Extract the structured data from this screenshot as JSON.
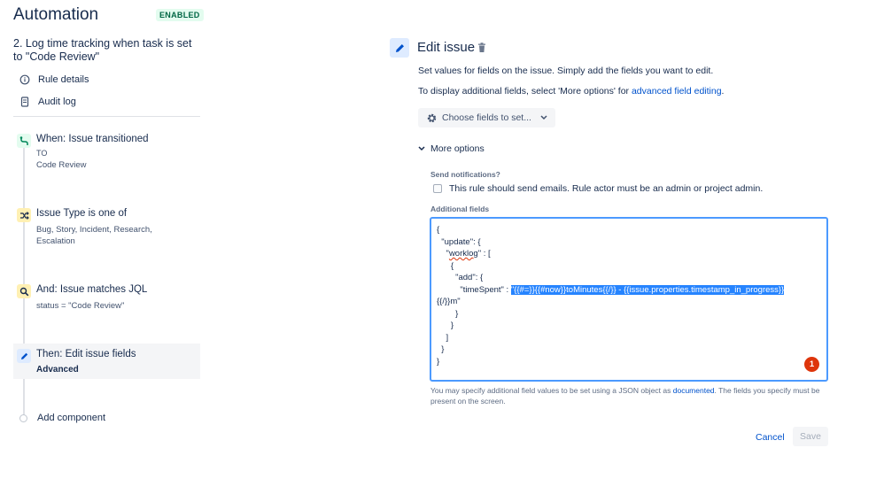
{
  "app": {
    "title": "Automation",
    "status_badge": "ENABLED"
  },
  "rule": {
    "name": "2. Log time tracking when task is set to \"Code Review\""
  },
  "nav": [
    {
      "label": "Rule details",
      "icon": "info-icon"
    },
    {
      "label": "Audit log",
      "icon": "document-icon"
    }
  ],
  "components": [
    {
      "title": "When: Issue transitioned",
      "subtitle_lines": [
        "TO",
        "Code Review"
      ],
      "icon": "transition-icon",
      "color": "#e3fcef"
    },
    {
      "title": "Issue Type is one of",
      "subtitle_lines": [
        "Bug, Story, Incident, Research,",
        "Escalation"
      ],
      "icon": "shuffle-icon",
      "color": "#fff0b3"
    },
    {
      "title": "And: Issue matches JQL",
      "subtitle_lines": [
        "status = \"Code Review\""
      ],
      "icon": "search-icon",
      "color": "#fff0b3"
    },
    {
      "title": "Then: Edit issue fields",
      "subtitle_lines": [
        "Advanced"
      ],
      "icon": "pencil-icon",
      "color": "#deebff",
      "selected": true
    }
  ],
  "add_component_label": "Add component",
  "panel": {
    "title": "Edit issue",
    "desc1": "Set values for fields on the issue. Simply add the fields you want to edit.",
    "desc2_prefix": "To display additional fields, select 'More options' for ",
    "desc2_link": "advanced field editing",
    "desc2_suffix": ".",
    "choose_fields_label": "Choose fields to set...",
    "more_options_label": "More options",
    "send_notifications_label": "Send notifications?",
    "send_emails_checkbox_label": "This rule should send emails. Rule actor must be an admin or project admin.",
    "send_emails_checked": false,
    "additional_fields_label": "Additional fields",
    "json": {
      "l1": "{",
      "l2": "  \"update\": {",
      "l3_pre": "    \"",
      "l3_word": "worklog",
      "l3_post": "\" : [",
      "l4": "      {",
      "l5": "        \"add\": {",
      "l6_pre": "          \"timeSpent\" : ",
      "l6_hl": "\"{{#=}}{{#now}}toMinutes{{/}} - {{issue.properties.timestamp_in_progress}}",
      "l7": "{{/}}m\"",
      "l8": "        }",
      "l9": "      }",
      "l10": "    ]",
      "l11": "  }",
      "l12": "}"
    },
    "error_count": "1",
    "helper_prefix": "You may specify additional field values to be set using a JSON object as ",
    "helper_link": "documented",
    "helper_suffix": ". The fields you specify must be present on the screen.",
    "cancel_label": "Cancel",
    "save_label": "Save"
  }
}
